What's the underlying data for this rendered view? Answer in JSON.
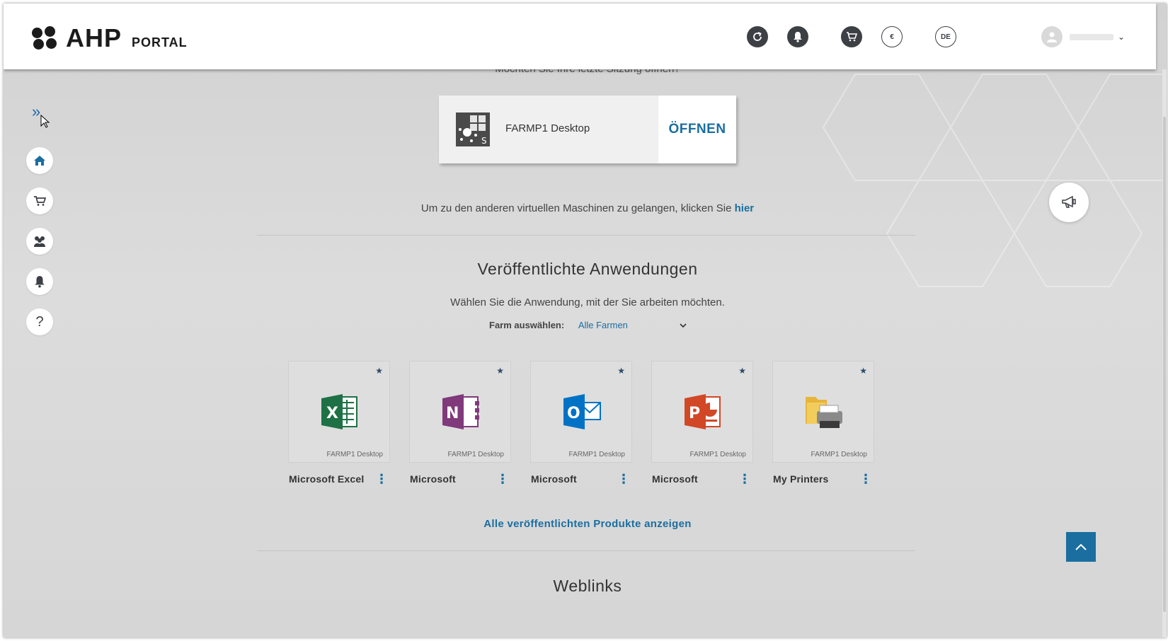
{
  "header": {
    "logo_name": "AHP",
    "logo_portal": "PORTAL",
    "icons": [
      "refresh-icon",
      "bell-icon",
      "cart-icon",
      "currency-euro-icon",
      "language-icon"
    ],
    "currency_label": "€",
    "language_label": "DE",
    "user_caret": "⌄"
  },
  "sidebar": {
    "toggle": "»",
    "items": [
      {
        "name": "home",
        "icon": "home-icon"
      },
      {
        "name": "shop",
        "icon": "cart-icon"
      },
      {
        "name": "users",
        "icon": "users-icon"
      },
      {
        "name": "notifications",
        "icon": "bell-icon"
      },
      {
        "name": "help",
        "icon": "help-icon",
        "glyph": "?"
      }
    ]
  },
  "session": {
    "prompt": "Möchten Sie Ihre letzte Sitzung öffnen?",
    "desktop_name": "FARMP1 Desktop",
    "open_label": "ÖFFNEN",
    "vm_text": "Um zu den anderen virtuellen Maschinen zu gelangen, klicken Sie",
    "vm_link": "hier"
  },
  "apps_section": {
    "title": "Veröffentlichte Anwendungen",
    "subtitle": "Wählen Sie die Anwendung, mit der Sie arbeiten möchten.",
    "farm_label": "Farm auswählen:",
    "farm_value": "Alle Farmen",
    "apps": [
      {
        "name": "Microsoft Excel",
        "farm": "FARMP1 Desktop",
        "icon": "excel-icon"
      },
      {
        "name": "Microsoft",
        "farm": "FARMP1 Desktop",
        "icon": "onenote-icon"
      },
      {
        "name": "Microsoft",
        "farm": "FARMP1 Desktop",
        "icon": "outlook-icon"
      },
      {
        "name": "Microsoft",
        "farm": "FARMP1 Desktop",
        "icon": "powerpoint-icon"
      },
      {
        "name": "My Printers",
        "farm": "FARMP1 Desktop",
        "icon": "printer-icon"
      }
    ],
    "show_all": "Alle veröffentlichten Produkte anzeigen"
  },
  "weblinks": {
    "title": "Weblinks"
  },
  "colors": {
    "accent": "#1a6ea0",
    "dark_icon": "#3c3f44"
  }
}
